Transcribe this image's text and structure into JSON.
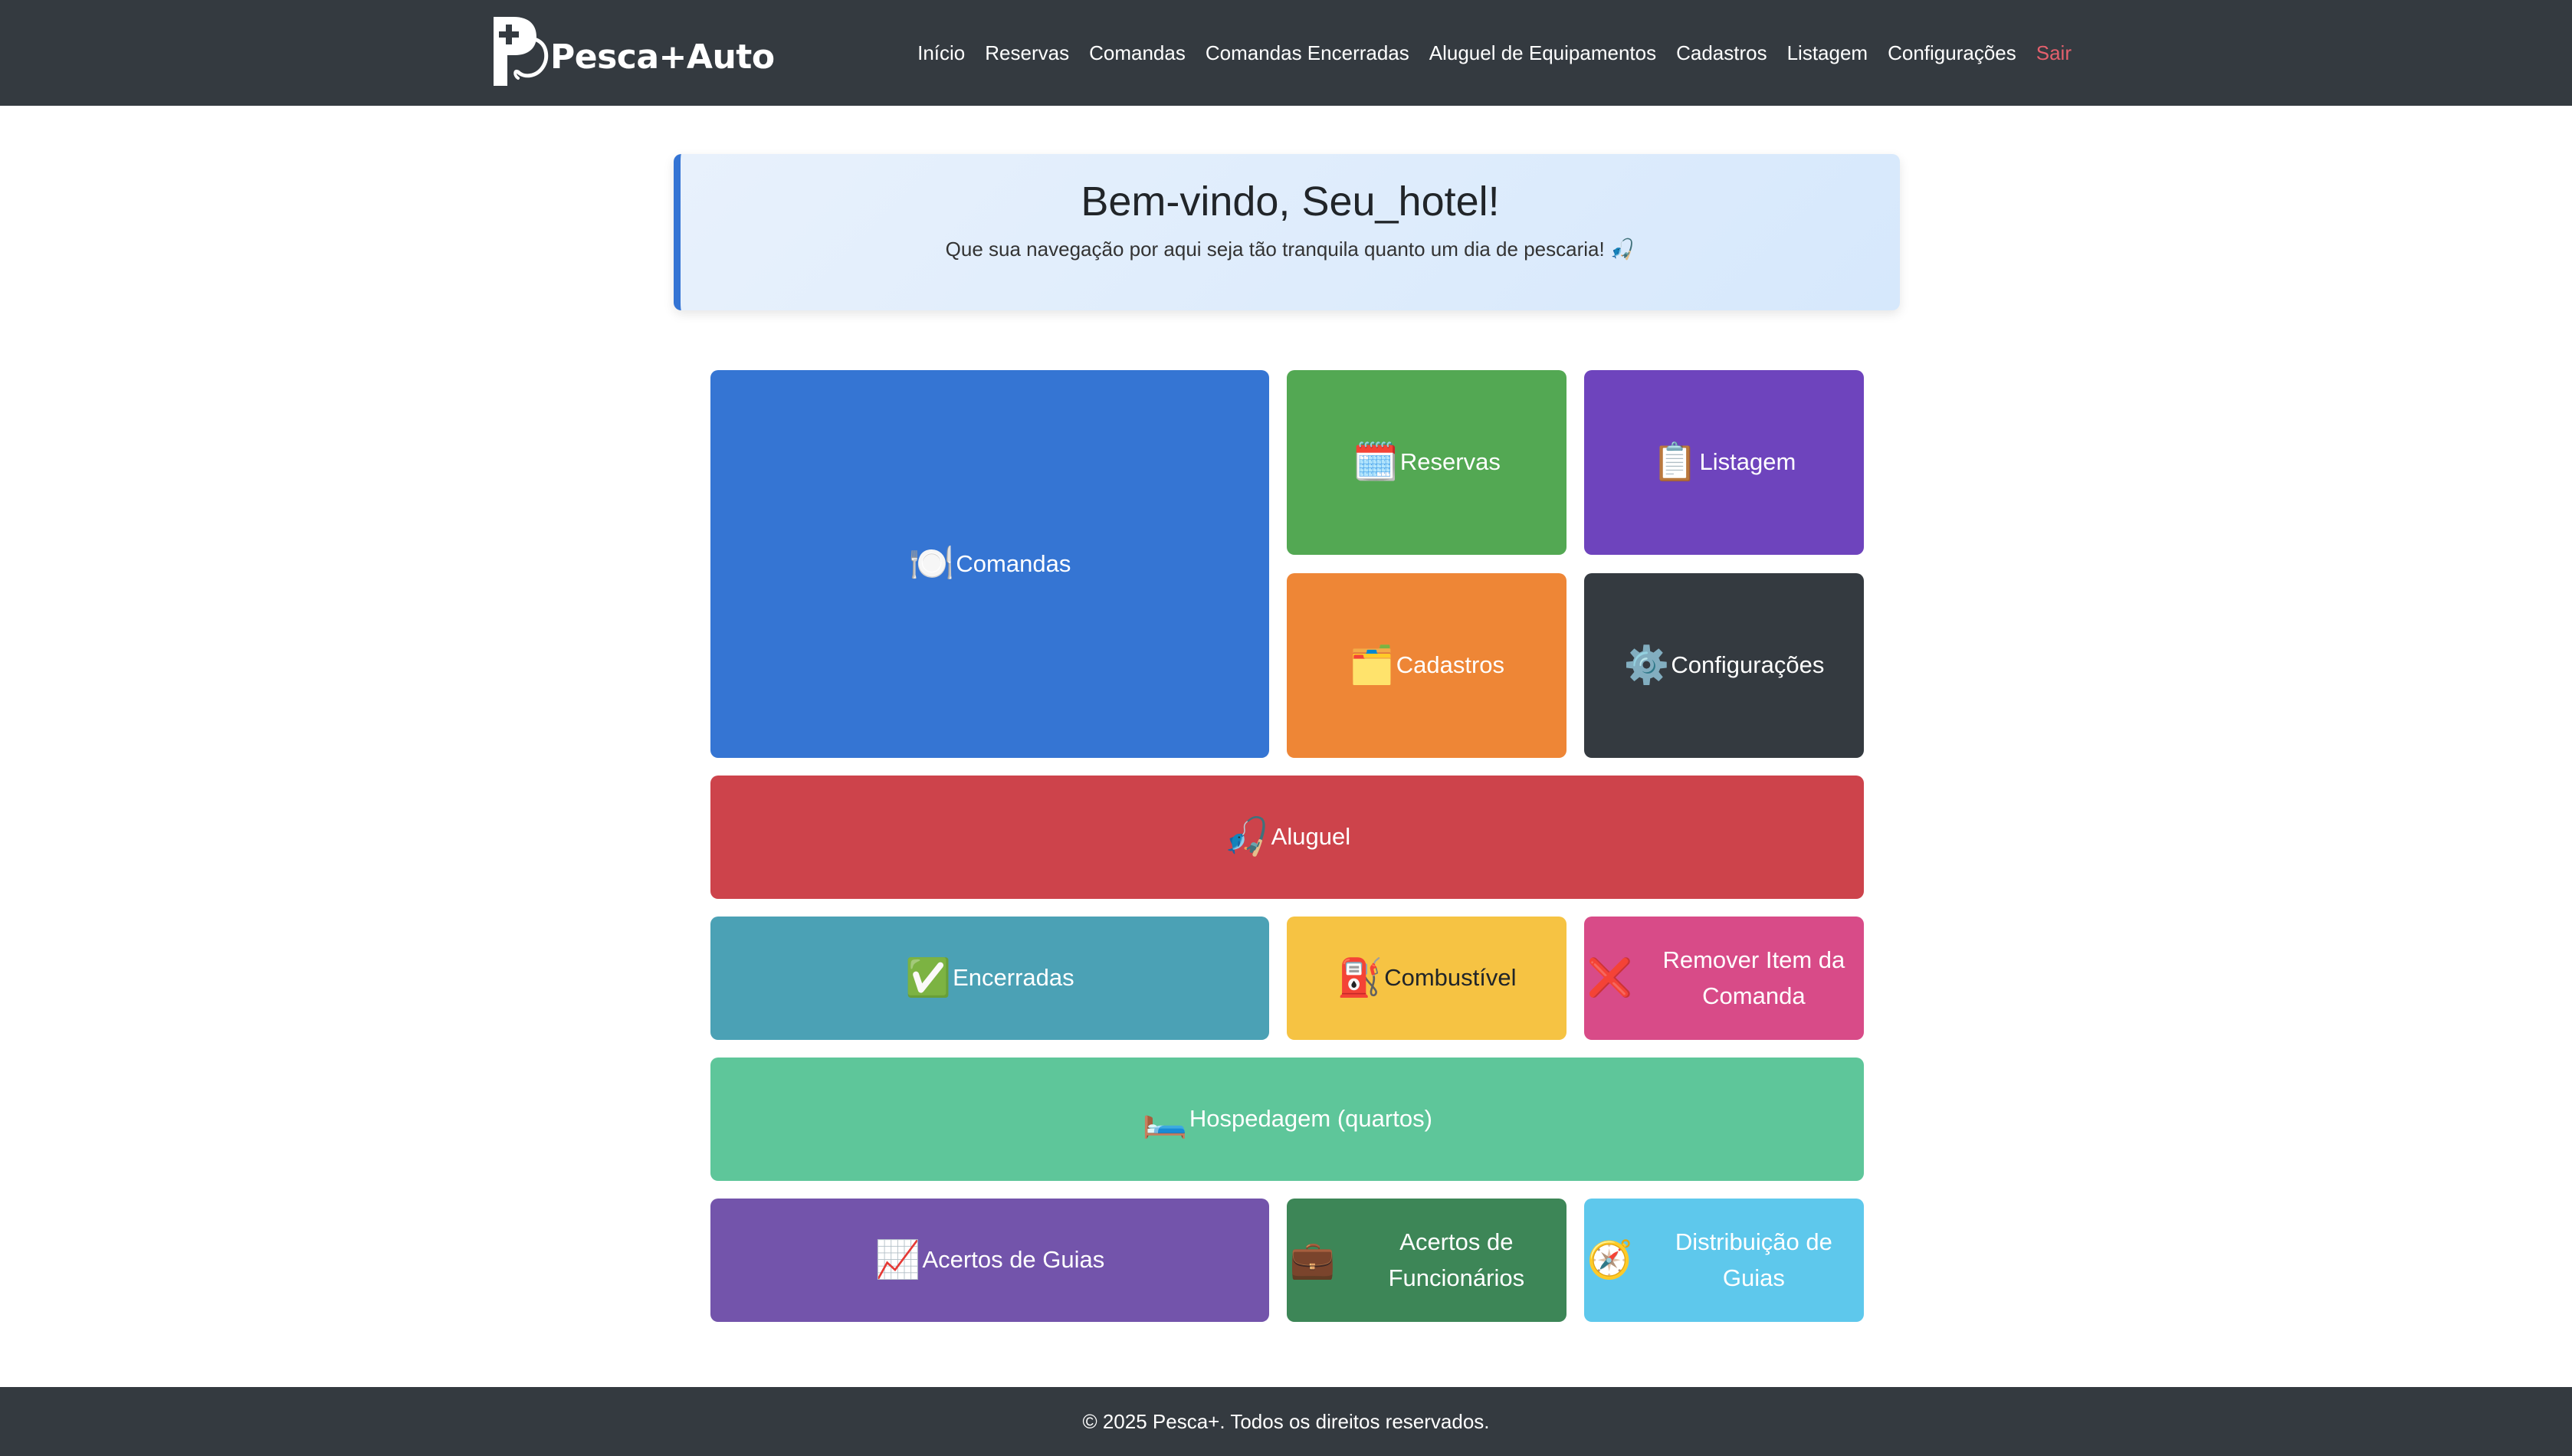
{
  "brand": {
    "name": "Pesca+Auto"
  },
  "nav": {
    "items": [
      {
        "label": "Início"
      },
      {
        "label": "Reservas"
      },
      {
        "label": "Comandas"
      },
      {
        "label": "Comandas Encerradas"
      },
      {
        "label": "Aluguel de Equipamentos"
      },
      {
        "label": "Cadastros"
      },
      {
        "label": "Listagem"
      },
      {
        "label": "Configurações"
      }
    ],
    "logout_label": "Sair"
  },
  "welcome": {
    "title": "Bem-vindo, Seu_hotel!",
    "subtitle": "Que sua navegação por aqui seja tão tranquila quanto um dia de pescaria! 🎣"
  },
  "tiles": {
    "comandas": {
      "icon": "🍽️",
      "icon_name": "plate-icon",
      "label": "Comandas",
      "color": "#3575d3"
    },
    "reservas": {
      "icon": "🗓️",
      "icon_name": "calendar-icon",
      "label": "Reservas",
      "color": "#53a853"
    },
    "listagem": {
      "icon": "📋",
      "icon_name": "clipboard-icon",
      "label": "Listagem",
      "color": "#6e44bd"
    },
    "cadastros": {
      "icon": "🗂️",
      "icon_name": "card-index-icon",
      "label": "Cadastros",
      "color": "#ee8636"
    },
    "config": {
      "icon": "⚙️",
      "icon_name": "gear-icon",
      "label": "Configurações",
      "color": "#343a40"
    },
    "aluguel": {
      "icon": "🎣",
      "icon_name": "fishing-rod-icon",
      "label": "Aluguel",
      "color": "#cd434b"
    },
    "encerradas": {
      "icon": "✅",
      "icon_name": "check-icon",
      "label": "Encerradas",
      "color": "#4ba1b5"
    },
    "combust": {
      "icon": "⛽",
      "icon_name": "fuel-pump-icon",
      "label": "Combustível",
      "color": "#f6c343"
    },
    "remover": {
      "icon": "❌",
      "icon_name": "cross-icon",
      "label": "Remover Item da Comanda",
      "color": "#d84b88"
    },
    "hosped": {
      "icon": "🛏️",
      "icon_name": "bed-icon",
      "label": "Hospedagem (quartos)",
      "color": "#5ec69a"
    },
    "acertos_g": {
      "icon": "📈",
      "icon_name": "chart-icon",
      "label": "Acertos de Guias",
      "color": "#7354ab"
    },
    "acertos_f": {
      "icon": "💼",
      "icon_name": "briefcase-icon",
      "label": "Acertos de Funcionários",
      "color": "#3d8657"
    },
    "distrib": {
      "icon": "🧭",
      "icon_name": "compass-icon",
      "label": "Distribuição de Guias",
      "color": "#5ec8ec"
    }
  },
  "footer": {
    "text": "© 2025 Pesca+. Todos os direitos reservados."
  }
}
